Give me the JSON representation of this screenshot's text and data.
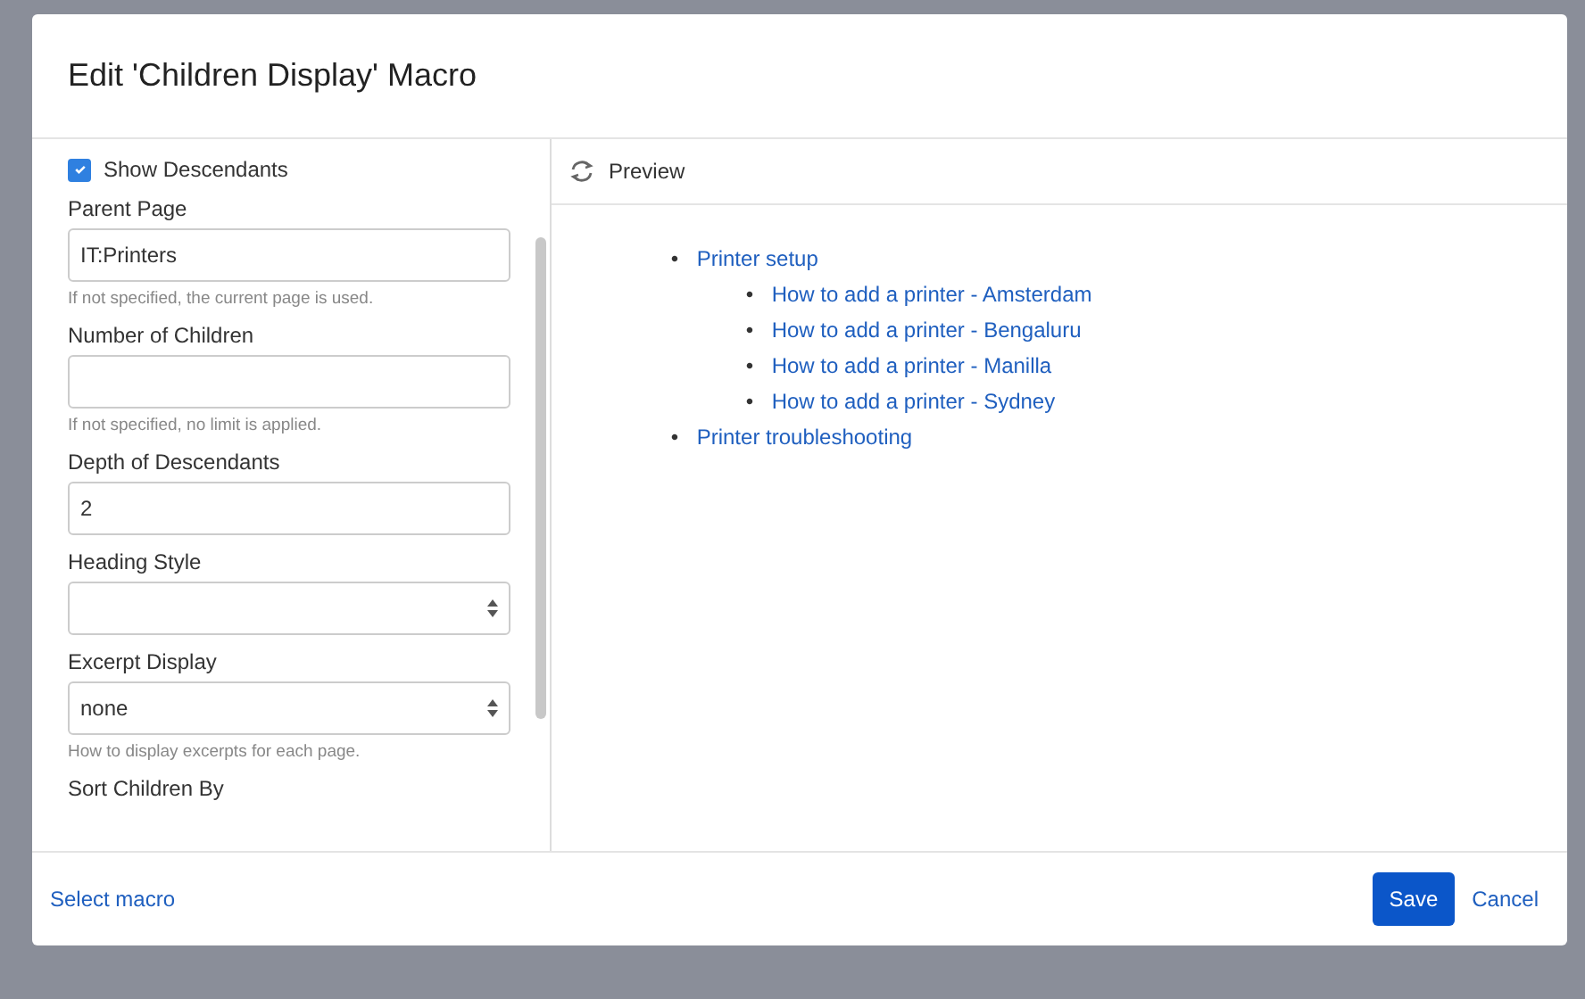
{
  "dialog": {
    "title": "Edit 'Children Display' Macro"
  },
  "form": {
    "show_descendants": {
      "label": "Show Descendants",
      "checked": true
    },
    "fields": [
      {
        "kind": "text",
        "label": "Parent Page",
        "value": "IT:Printers",
        "help": "If not specified, the current page is used."
      },
      {
        "kind": "text",
        "label": "Number of Children",
        "help": "If not specified, no limit is applied."
      },
      {
        "kind": "text",
        "label": "Depth of Descendants",
        "value": "2"
      },
      {
        "kind": "select",
        "label": "Heading Style"
      },
      {
        "kind": "select",
        "label": "Excerpt Display",
        "value": "none",
        "help": "How to display excerpts for each page."
      },
      {
        "kind": "label",
        "label": "Sort Children By"
      }
    ]
  },
  "preview": {
    "title": "Preview",
    "items": [
      {
        "bullet": "•",
        "text": "Printer setup",
        "children": [
          {
            "bullet": "•",
            "text": "How to add a printer - Amsterdam"
          },
          {
            "bullet": "•",
            "text": "How to add a printer - Bengaluru"
          },
          {
            "bullet": "•",
            "text": "How to add a printer - Manilla"
          },
          {
            "bullet": "•",
            "text": "How to add a printer - Sydney"
          }
        ]
      },
      {
        "bullet": "•",
        "text": "Printer troubleshooting"
      }
    ]
  },
  "footer": {
    "link": "Select macro",
    "buttons": [
      {
        "kind": "primary",
        "label": "Save"
      },
      {
        "kind": "link",
        "label": "Cancel"
      }
    ]
  }
}
